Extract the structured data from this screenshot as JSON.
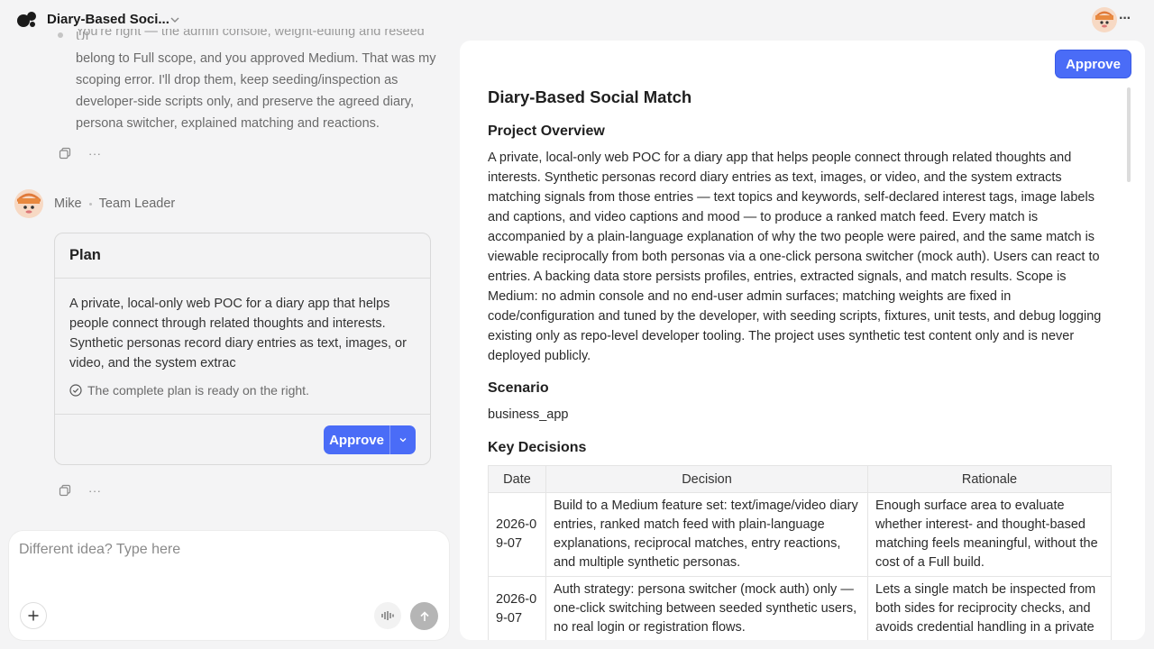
{
  "header": {
    "app_title": "Diary-Based Soci...",
    "logo_icon": "two-dots-logo",
    "more_label": "···"
  },
  "chat": {
    "previous_message": {
      "lines_faded": "You're right — the admin console, weight-editing and reseed UI",
      "body": "belong to Full scope, and you approved Medium. That was my scoping error. I'll drop them, keep seeding/inspection as developer-side scripts only, and preserve the agreed diary, persona switcher, explained matching and reactions."
    },
    "actions_more": "···",
    "agent": {
      "name": "Mike",
      "role": "Team Leader"
    },
    "plan_card": {
      "title": "Plan",
      "summary": "A private, local-only web POC for a diary app that helps people connect through related thoughts and interests. Synthetic personas record diary entries as text, images, or video, and the system extrac",
      "ready_text": "The complete plan is ready on the right.",
      "approve_label": "Approve"
    },
    "composer": {
      "placeholder": "Different idea? Type here"
    }
  },
  "document": {
    "approve_label": "Approve",
    "title": "Diary-Based Social Match",
    "sections": {
      "overview_heading": "Project Overview",
      "overview_text": "A private, local-only web POC for a diary app that helps people connect through related thoughts and interests. Synthetic personas record diary entries as text, images, or video, and the system extracts matching signals from those entries — text topics and keywords, self-declared interest tags, image labels and captions, and video captions and mood — to produce a ranked match feed. Every match is accompanied by a plain-language explanation of why the two people were paired, and the same match is viewable reciprocally from both personas via a one-click persona switcher (mock auth). Users can react to entries. A backing data store persists profiles, entries, extracted signals, and match results. Scope is Medium: no admin console and no end-user admin surfaces; matching weights are fixed in code/configuration and tuned by the developer, with seeding scripts, fixtures, unit tests, and debug logging existing only as repo-level developer tooling. The project uses synthetic test content only and is never deployed publicly.",
      "scenario_heading": "Scenario",
      "scenario_text": "business_app",
      "decisions_heading": "Key Decisions"
    },
    "decisions_table": {
      "headers": [
        "Date",
        "Decision",
        "Rationale"
      ],
      "rows": [
        {
          "date": "2026-09-07",
          "decision": "Build to a Medium feature set: text/image/video diary entries, ranked match feed with plain-language explanations, reciprocal matches, entry reactions, and multiple synthetic personas.",
          "rationale": "Enough surface area to evaluate whether interest- and thought-based matching feels meaningful, without the cost of a Full build."
        },
        {
          "date": "2026-09-07",
          "decision": "Auth strategy: persona switcher (mock auth) only — one-click switching between seeded synthetic users, no real login or registration flows.",
          "rationale": "Lets a single match be inspected from both sides for reciprocity checks, and avoids credential handling in a private"
        }
      ]
    }
  }
}
